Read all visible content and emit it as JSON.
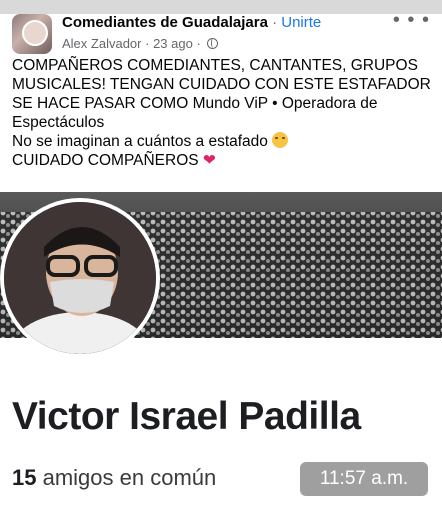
{
  "group": {
    "name": "Comediantes de Guadalajara",
    "separator": "·",
    "join_label": "Unirte",
    "more_icon": "more-options-icon"
  },
  "post": {
    "author": "Alex Zalvador",
    "time": "23 ago",
    "privacy_icon": "globe-icon",
    "lines": [
      "COMPAÑEROS COMEDIANTES, CANTANTES, GRUPOS",
      "MUSICALES! TENGAN CUIDADO CON ESTE ESTAFADOR",
      "SE HACE PASAR COMO Mundo ViP • Operadora de",
      "Espectáculos",
      "No se imaginan a cuántos a estafado",
      "CUIDADO COMPAÑEROS"
    ],
    "emoji_icon": "crying-emoji-icon",
    "heart_icon": "red-heart-icon"
  },
  "profile_card": {
    "name": "Victor Israel Padilla",
    "mutual_count": "15",
    "mutual_label": "amigos en común",
    "timestamp": "11:57 a.m."
  },
  "colors": {
    "link": "#1877f2",
    "meta": "#65676b",
    "heart": "#e0245e"
  }
}
